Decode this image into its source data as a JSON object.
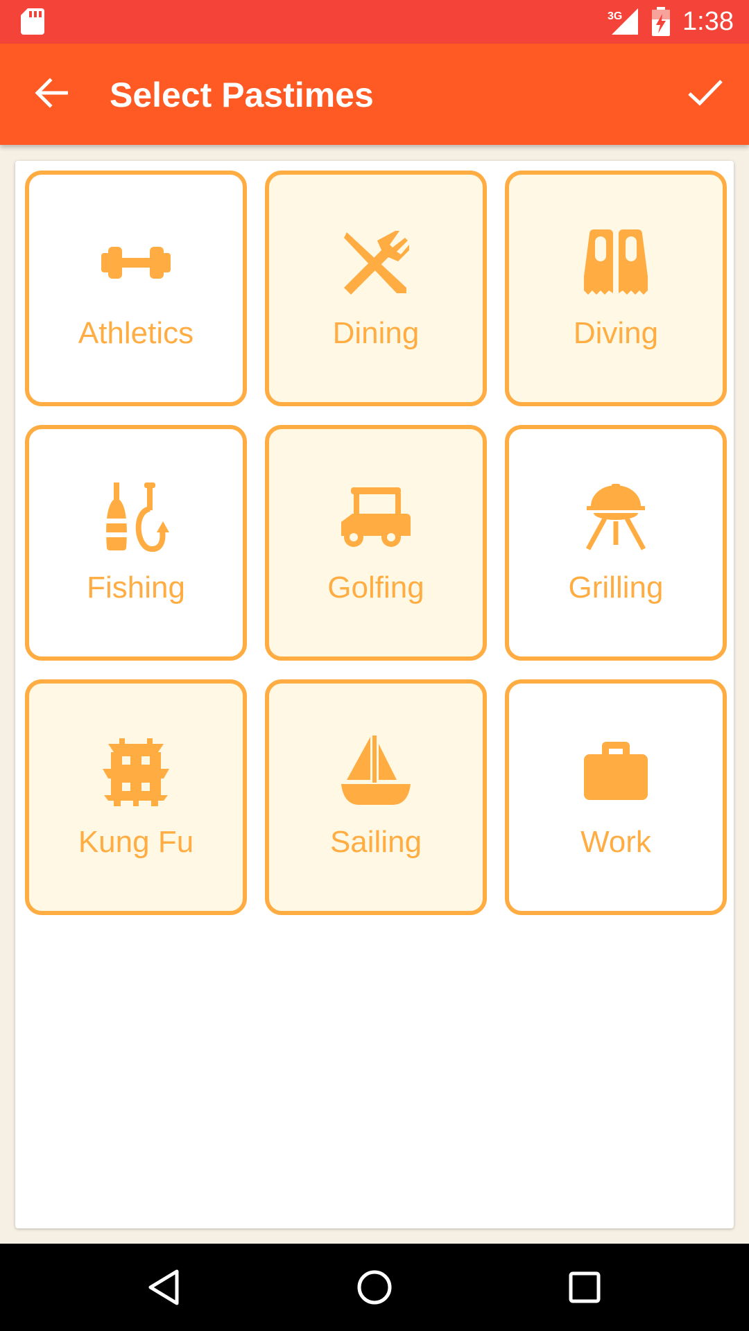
{
  "status_bar": {
    "time": "1:38",
    "network_label": "3G",
    "icons": [
      "sd-card-icon",
      "signal-icon",
      "battery-charging-icon"
    ]
  },
  "app_bar": {
    "title": "Select Pastimes",
    "back_icon": "arrow-back-icon",
    "done_icon": "check-icon",
    "color": "#FF5A24"
  },
  "theme": {
    "accent": "#FFAD42",
    "selected_background": "#FFF8E4",
    "status_bar_color": "#F4443A"
  },
  "pastimes": [
    {
      "label": "Athletics",
      "icon": "dumbbell-icon",
      "selected": false
    },
    {
      "label": "Dining",
      "icon": "fork-knife-icon",
      "selected": true
    },
    {
      "label": "Diving",
      "icon": "flippers-icon",
      "selected": true
    },
    {
      "label": "Fishing",
      "icon": "fishing-hook-icon",
      "selected": false
    },
    {
      "label": "Golfing",
      "icon": "golf-cart-icon",
      "selected": true
    },
    {
      "label": "Grilling",
      "icon": "grill-icon",
      "selected": false
    },
    {
      "label": "Kung Fu",
      "icon": "pagoda-icon",
      "selected": true
    },
    {
      "label": "Sailing",
      "icon": "sailboat-icon",
      "selected": true
    },
    {
      "label": "Work",
      "icon": "briefcase-icon",
      "selected": false
    }
  ],
  "nav_bar": {
    "buttons": [
      "back-triangle-icon",
      "home-circle-icon",
      "recents-square-icon"
    ]
  }
}
